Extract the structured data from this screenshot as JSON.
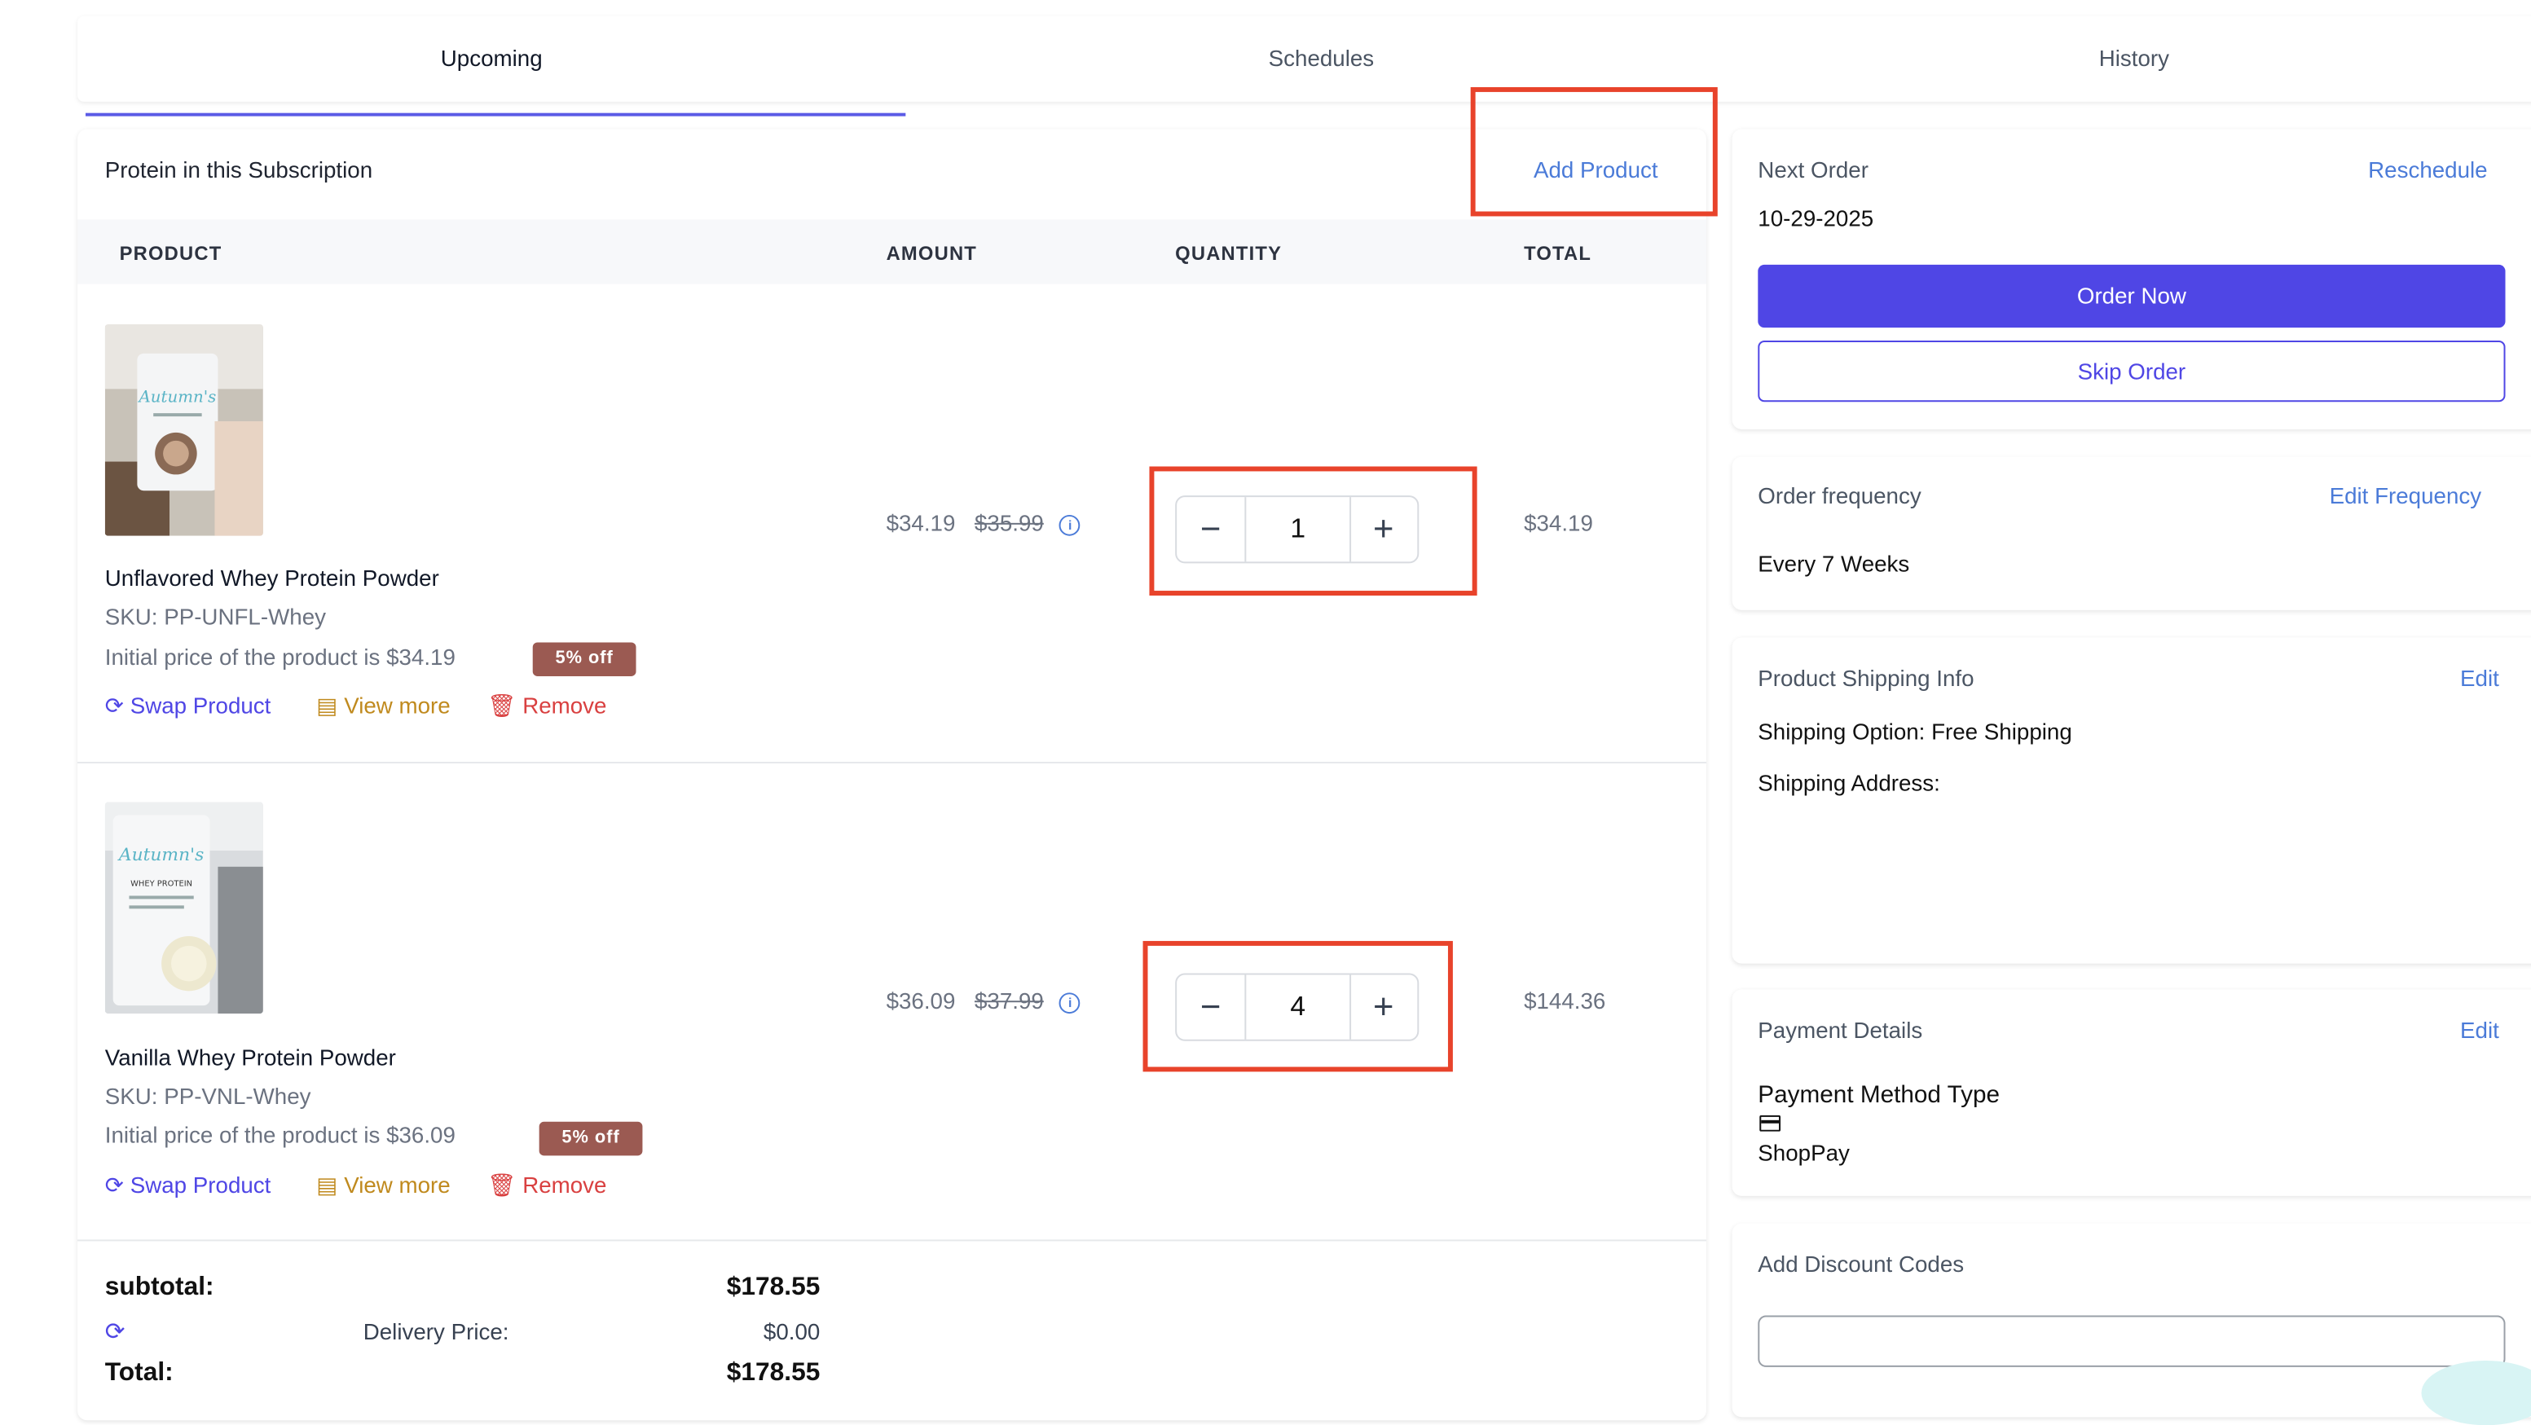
{
  "tabs": [
    {
      "label": "Upcoming",
      "active": true
    },
    {
      "label": "Schedules",
      "active": false
    },
    {
      "label": "History",
      "active": false
    }
  ],
  "subscription": {
    "title": "Protein in this Subscription",
    "add_product": "Add Product",
    "columns": {
      "product": "PRODUCT",
      "amount": "AMOUNT",
      "quantity": "QUANTITY",
      "total": "TOTAL"
    },
    "items": [
      {
        "name": "Unflavored Whey Protein Powder",
        "sku": "SKU: PP-UNFL-Whey",
        "initial_price": "Initial price of the product is $34.19",
        "badge": "5% off",
        "price": "$34.19",
        "original_price": "$35.99",
        "quantity": "1",
        "total": "$34.19",
        "actions": {
          "swap": "Swap Product",
          "view": "View more",
          "remove": "Remove"
        }
      },
      {
        "name": "Vanilla Whey Protein Powder",
        "sku": "SKU: PP-VNL-Whey",
        "initial_price": "Initial price of the product is $36.09",
        "badge": "5% off",
        "price": "$36.09",
        "original_price": "$37.99",
        "quantity": "4",
        "total": "$144.36",
        "actions": {
          "swap": "Swap Product",
          "view": "View more",
          "remove": "Remove"
        }
      }
    ],
    "summary": {
      "subtotal_label": "subtotal:",
      "subtotal_value": "$178.55",
      "delivery_label": "Delivery Price:",
      "delivery_value": "$0.00",
      "total_label": "Total:",
      "total_value": "$178.55"
    }
  },
  "next_order": {
    "label": "Next Order",
    "reschedule": "Reschedule",
    "date": "10-29-2025",
    "order_now": "Order Now",
    "skip_order": "Skip Order"
  },
  "frequency": {
    "label": "Order frequency",
    "edit": "Edit Frequency",
    "value": "Every 7 Weeks"
  },
  "shipping": {
    "label": "Product Shipping Info",
    "edit": "Edit",
    "option": "Shipping Option: Free Shipping",
    "address": "Shipping Address:"
  },
  "payment": {
    "label": "Payment Details",
    "edit": "Edit",
    "method_label": "Payment Method Type",
    "method_value": "ShopPay"
  },
  "discount": {
    "label": "Add Discount Codes",
    "placeholder": ""
  },
  "colors": {
    "accent": "#4f46e5",
    "link": "#4b7bd8",
    "highlight": "#e8432b",
    "badge": "#9b5a52",
    "view_more": "#c08a1e",
    "remove": "#d94040"
  }
}
